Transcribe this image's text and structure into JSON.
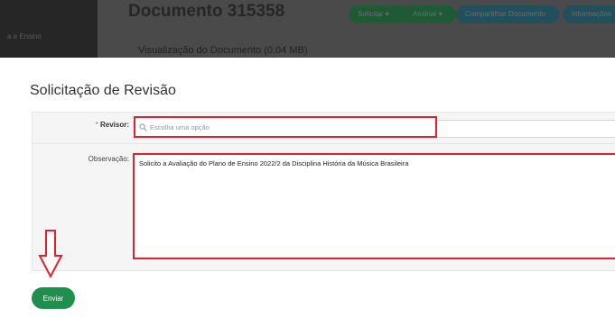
{
  "background": {
    "sidebar_text": "a e Ensino",
    "document_title": "Documento 315358",
    "document_view": "Visualização do Documento (0.04 MB)",
    "buttons": [
      {
        "label": "Solicitar ▾",
        "color": "#1e5a34"
      },
      {
        "label": "Assinar ▾",
        "color": "#1e5a34"
      },
      {
        "label": "Compartilhar Documento",
        "color": "#214f5c"
      },
      {
        "label": "Informações",
        "color": "#214f5c"
      }
    ]
  },
  "modal": {
    "title": "Solicitação de Revisão",
    "revisor": {
      "required_marker": "*",
      "label": "Revisor:",
      "placeholder": "Escolha uma opção",
      "icon": "search-icon"
    },
    "observacao": {
      "label": "Observação:",
      "value": "Solicito a Avaliação do Plano de Ensino 2022/2 da Disciplina História da Música Brasileira"
    },
    "submit_label": "Enviar",
    "annotation_color": "#e2202b"
  }
}
